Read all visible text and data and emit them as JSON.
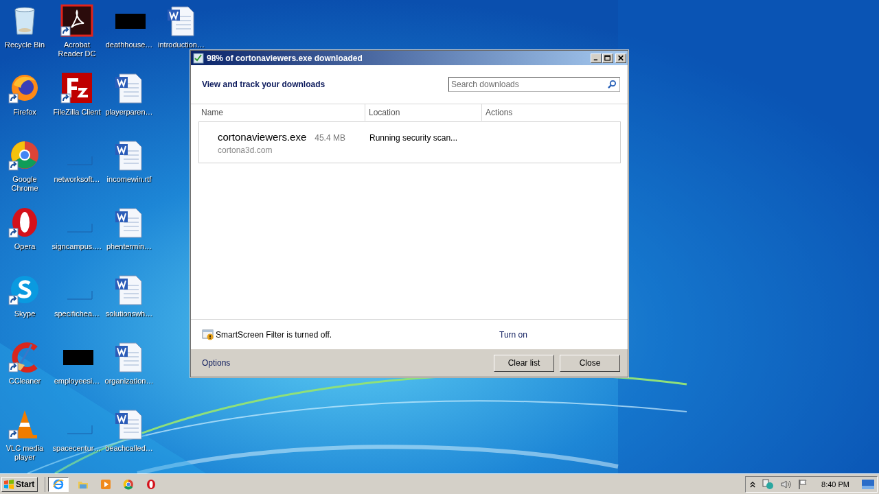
{
  "desktop_icons": [
    {
      "label": "Recycle Bin",
      "kind": "recycle",
      "shortcut": false
    },
    {
      "label": "Firefox",
      "kind": "firefox",
      "shortcut": true
    },
    {
      "label": "Google Chrome",
      "kind": "chrome",
      "shortcut": true
    },
    {
      "label": "Opera",
      "kind": "opera",
      "shortcut": true
    },
    {
      "label": "Skype",
      "kind": "skype",
      "shortcut": true
    },
    {
      "label": "CCleaner",
      "kind": "ccleaner",
      "shortcut": true
    },
    {
      "label": "VLC media player",
      "kind": "vlc",
      "shortcut": true
    },
    {
      "label": "Acrobat Reader DC",
      "kind": "acrobat",
      "shortcut": true
    },
    {
      "label": "FileZilla Client",
      "kind": "filezilla",
      "shortcut": true
    },
    {
      "label": "networksoft…",
      "kind": "blank",
      "shortcut": false
    },
    {
      "label": "signcampus.…",
      "kind": "blank",
      "shortcut": false
    },
    {
      "label": "specifichea…",
      "kind": "blank",
      "shortcut": false
    },
    {
      "label": "employeesi…",
      "kind": "black",
      "shortcut": false
    },
    {
      "label": "spacecentur…",
      "kind": "blank",
      "shortcut": false
    },
    {
      "label": "deathhouse…",
      "kind": "black",
      "shortcut": false
    },
    {
      "label": "playerparen…",
      "kind": "word",
      "shortcut": false
    },
    {
      "label": "incomewin.rtf",
      "kind": "word",
      "shortcut": false
    },
    {
      "label": "phentermin…",
      "kind": "word",
      "shortcut": false
    },
    {
      "label": "solutionswh…",
      "kind": "word",
      "shortcut": false
    },
    {
      "label": "organization…",
      "kind": "word",
      "shortcut": false
    },
    {
      "label": "beachcalled…",
      "kind": "word",
      "shortcut": false
    },
    {
      "label": "introduction…",
      "kind": "word",
      "shortcut": false
    }
  ],
  "window": {
    "title": "98% of cortonaviewers.exe downloaded",
    "heading": "View and track your downloads",
    "search": {
      "placeholder": "Search downloads"
    },
    "columns": [
      "Name",
      "Location",
      "Actions"
    ],
    "downloads": [
      {
        "file": "cortonaviewers.exe",
        "size": "45.4 MB",
        "source": "cortona3d.com",
        "status": "Running security scan..."
      }
    ],
    "smartscreen": {
      "message": "SmartScreen Filter is turned off.",
      "link": "Turn on"
    },
    "options_link": "Options",
    "buttons": [
      "Clear list",
      "Close"
    ]
  },
  "taskbar": {
    "start": "Start",
    "apps": [
      {
        "kind": "ie",
        "selected": true
      },
      {
        "kind": "folder",
        "selected": false
      },
      {
        "kind": "media",
        "selected": false
      },
      {
        "kind": "chrome",
        "selected": false
      },
      {
        "kind": "opera",
        "selected": false
      }
    ],
    "clock": "8:40 PM"
  }
}
